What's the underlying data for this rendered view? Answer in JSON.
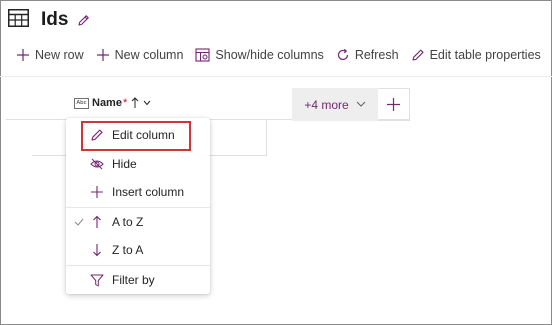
{
  "header": {
    "title": "Ids"
  },
  "toolbar": {
    "new_row": "New row",
    "new_column": "New column",
    "show_hide": "Show/hide columns",
    "refresh": "Refresh",
    "edit_props": "Edit table properties"
  },
  "grid": {
    "column_name": "Name",
    "required_marker": "*",
    "more_label": "+4 more",
    "abc_badge": "Abc"
  },
  "menu": {
    "items": [
      {
        "label": "Edit column",
        "icon": "pencil-icon"
      },
      {
        "label": "Hide",
        "icon": "eye-hide-icon"
      },
      {
        "label": "Insert column",
        "icon": "plus-icon"
      },
      {
        "label": "A to Z",
        "icon": "arrow-up-icon",
        "checked": true
      },
      {
        "label": "Z to A",
        "icon": "arrow-down-icon"
      },
      {
        "label": "Filter by",
        "icon": "filter-icon"
      }
    ]
  },
  "colors": {
    "accent": "#742774",
    "highlight": "#d13438"
  }
}
